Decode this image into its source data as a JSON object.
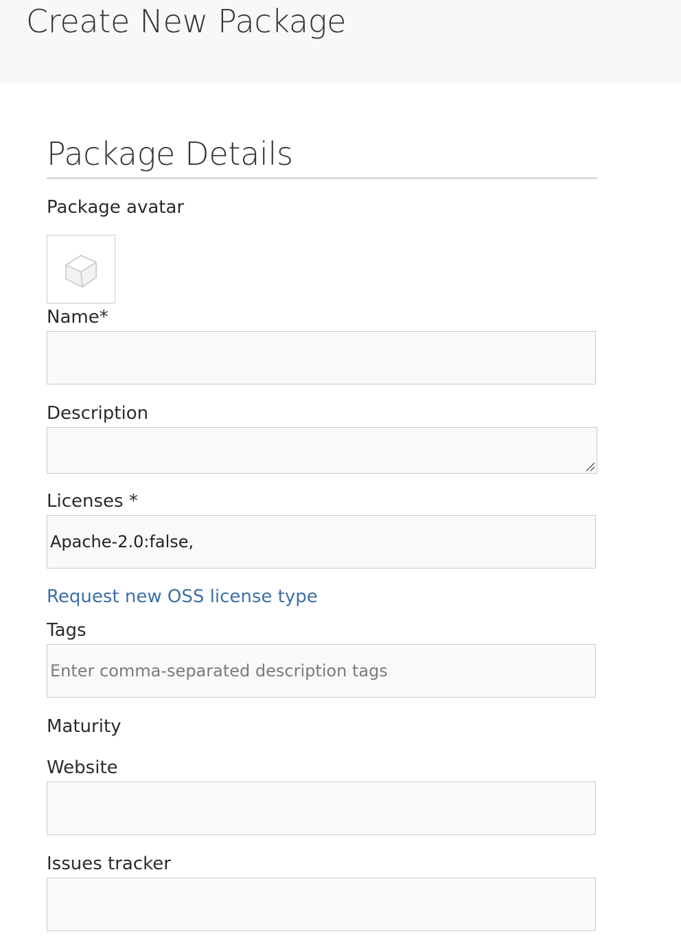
{
  "header": {
    "title": "Create New Package"
  },
  "section": {
    "title": "Package Details"
  },
  "avatar": {
    "label": "Package avatar",
    "icon": "package-cube-icon"
  },
  "fields": {
    "name": {
      "label": "Name*",
      "value": ""
    },
    "description": {
      "label": "Description",
      "value": ""
    },
    "licenses": {
      "label": "Licenses *",
      "value": "Apache-2.0:false,"
    },
    "tags": {
      "label": "Tags",
      "value": "",
      "placeholder": "Enter comma-separated description tags"
    },
    "maturity": {
      "label": "Maturity"
    },
    "website": {
      "label": "Website",
      "value": ""
    },
    "issues_tracker": {
      "label": "Issues tracker",
      "value": ""
    }
  },
  "links": {
    "request_license": "Request new OSS license type"
  },
  "colors": {
    "header_bg": "#f8f8f8",
    "field_bg": "#f9f9f9",
    "field_border": "#cccccc",
    "link": "#3d6fa5"
  }
}
